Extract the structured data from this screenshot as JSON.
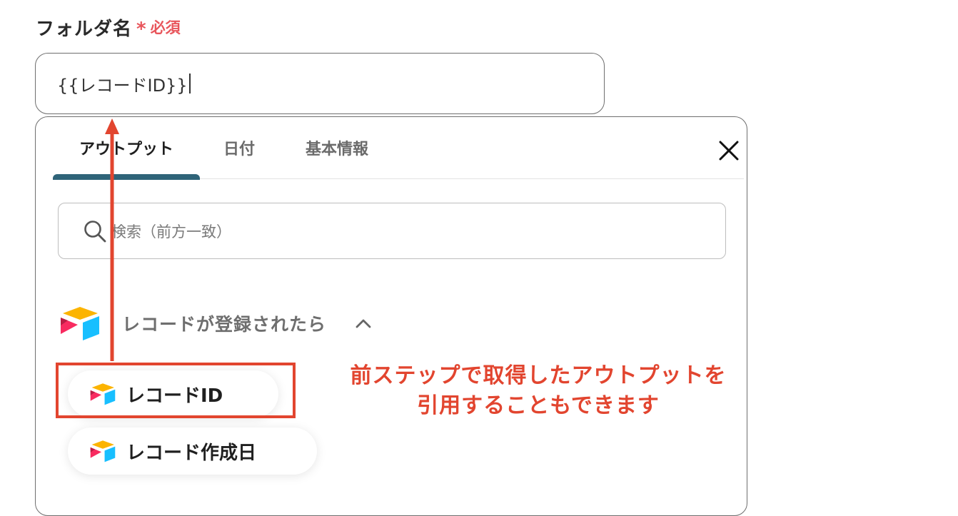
{
  "field": {
    "label": "フォルダ名",
    "required_mark": "*",
    "required_text": "必須",
    "value": "{{レコードID}}"
  },
  "panel": {
    "tabs": [
      {
        "label": "アウトプット",
        "active": true
      },
      {
        "label": "日付",
        "active": false
      },
      {
        "label": "基本情報",
        "active": false
      }
    ],
    "search_placeholder": "検索（前方一致）",
    "group": {
      "title": "レコードが登録されたら",
      "expanded": true,
      "icon": "airtable-logo-icon"
    },
    "items": [
      {
        "label": "レコードID"
      },
      {
        "label": "レコード作成日"
      }
    ]
  },
  "annotation": {
    "line1": "前ステップで取得したアウトプットを",
    "line2": "引用することもできます",
    "color": "#e2452f"
  },
  "colors": {
    "accent_tab": "#2f6479",
    "required": "#e8555b"
  }
}
